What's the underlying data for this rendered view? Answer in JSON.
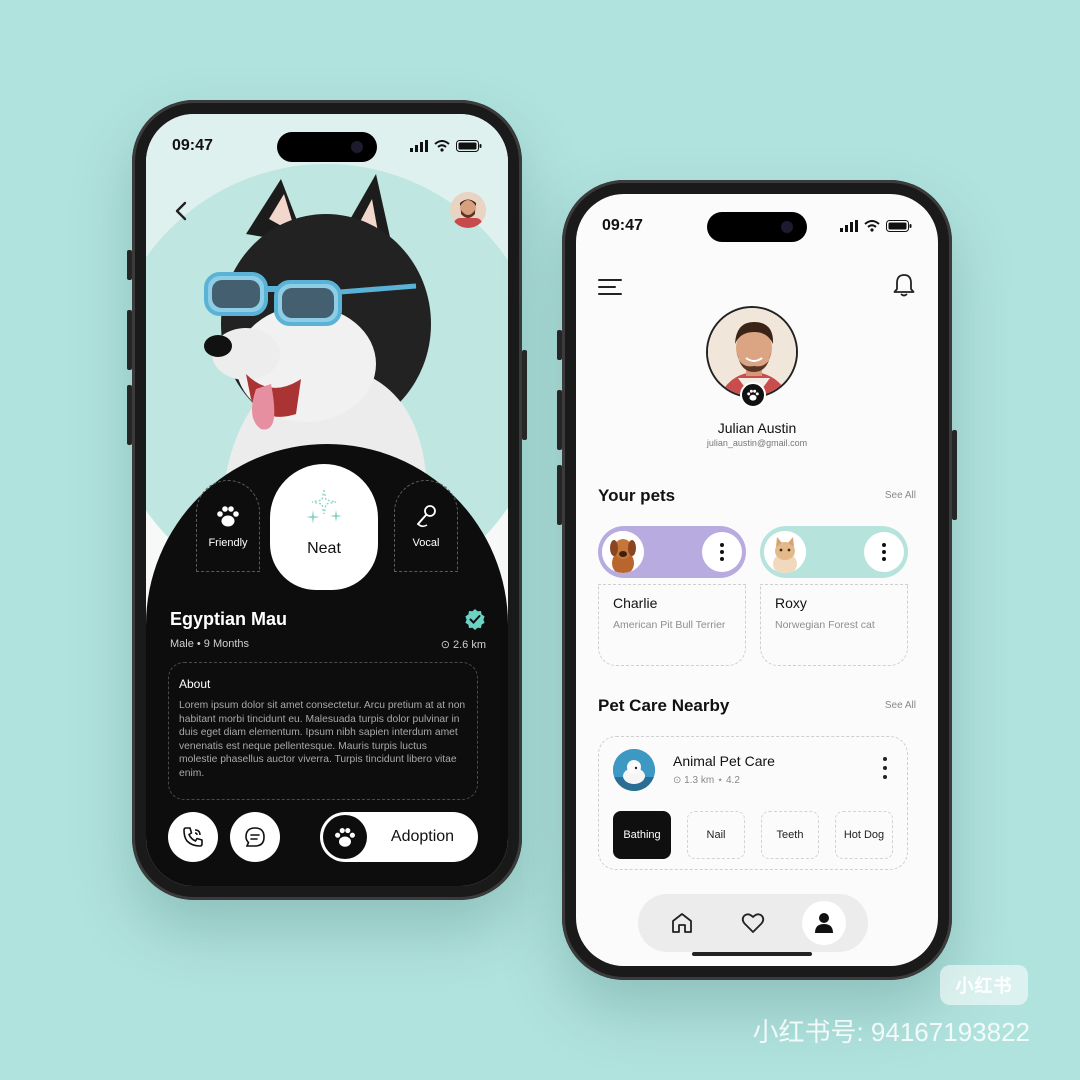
{
  "colors": {
    "background": "#b1e3de",
    "panel_dark": "#0d0d0d",
    "charlie_accent": "#b7abdf",
    "roxy_accent": "#b7e3dd",
    "verified": "#6bd3c3"
  },
  "profile_screen": {
    "status_time": "09:47",
    "traits": {
      "friendly": "Friendly",
      "neat": "Neat",
      "vocal": "Vocal"
    },
    "pet_name": "Egyptian Mau",
    "pet_meta": "Male • 9 Months",
    "pet_distance": "⊙ 2.6 km",
    "about_title": "About",
    "about_text": "Lorem ipsum dolor sit amet consectetur. Arcu pretium at at non habitant morbi tincidunt eu. Malesuada turpis dolor pulvinar in duis eget diam elementum. Ipsum nibh sapien interdum amet venenatis est neque pellentesque. Mauris turpis luctus molestie phasellus auctor viverra. Turpis tincidunt libero vitae enim.",
    "adopt_label": "Adoption",
    "icons": [
      "back-icon",
      "paw-icon",
      "sparkle-icon",
      "microphone-icon",
      "verified-icon",
      "phone-icon",
      "chat-icon"
    ]
  },
  "home_screen": {
    "status_time": "09:47",
    "user_name": "Julian Austin",
    "user_email": "julian_austin@gmail.com",
    "your_pets_title": "Your pets",
    "see_all": "See All",
    "pets": [
      {
        "name": "Charlie",
        "breed": "American Pit Bull Terrier"
      },
      {
        "name": "Roxy",
        "breed": "Norwegian Forest cat"
      }
    ],
    "nearby_title": "Pet Care Nearby",
    "nearby_see_all": "See All",
    "care": {
      "name": "Animal Pet Care",
      "meta": "⊙ 1.3 km  ⋆ 4.2",
      "services": [
        "Bathing",
        "Nail",
        "Teeth",
        "Hot Dog"
      ],
      "active_service": "Bathing"
    },
    "tabs": [
      "home",
      "favorites",
      "profile"
    ],
    "active_tab": "profile"
  },
  "watermark": {
    "badge": "小红书",
    "text": "小红书号: 94167193822"
  }
}
